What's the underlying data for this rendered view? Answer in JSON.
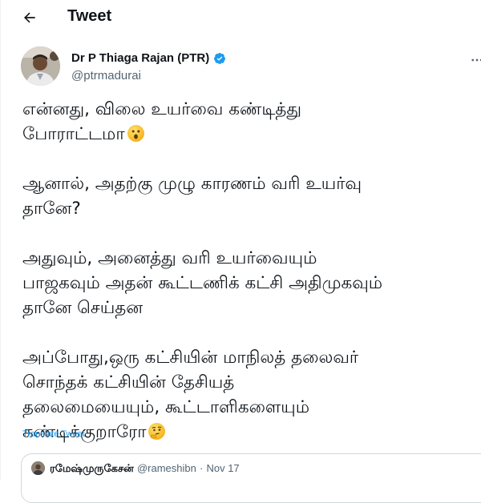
{
  "header": {
    "back_icon": "arrow-left-icon",
    "title": "Tweet"
  },
  "author": {
    "name": "Dr P Thiaga Rajan (PTR)",
    "handle": "@ptrmadurai",
    "verified_icon": "verified-badge-icon",
    "verified_color": "#1d9bf0"
  },
  "more_icon": "more-horizontal-icon",
  "tweet": {
    "paragraphs": [
      {
        "lines": [
          "என்னது, விலை உயர்வை கண்டித்து",
          "போராட்டமா"
        ]
      },
      {
        "lines": [
          "ஆனால், அதற்கு முழு காரணம் வரி உயர்வு",
          "தானே?"
        ]
      },
      {
        "lines": [
          "அதுவும், அனைத்து வரி உயர்வையும்",
          "பாஜகவும் அதன் கூட்டணிக் கட்சி அதிமுகவும்",
          "தானே செய்தன"
        ]
      },
      {
        "lines": [
          "அப்போது,ஒரு கட்சியின் மாநிலத் தலைவர்",
          "சொந்தக் கட்சியின் தேசியத்",
          "தலைமையையும், கூட்டாளிகளையும்",
          "கண்டிக்குறாரோ"
        ]
      }
    ],
    "emojis": [
      "surprised-face-emoji",
      "thinking-face-emoji"
    ]
  },
  "translate_label": "Translate Tweet",
  "quote": {
    "name": "ரமேஷ்முருகேசன்",
    "handle": "@rameshibn",
    "separator": "·",
    "date": "Nov 17"
  },
  "colors": {
    "accent": "#1d9bf0",
    "text": "#0f1419",
    "secondary": "#536471",
    "border": "#cfd9de"
  }
}
